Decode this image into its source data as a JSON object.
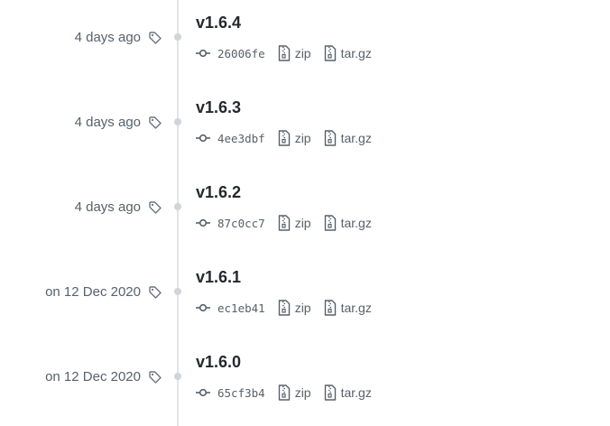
{
  "releases": [
    {
      "date": "4 days ago",
      "title": "v1.6.4",
      "commit": "26006fe",
      "assets": [
        "zip",
        "tar.gz"
      ]
    },
    {
      "date": "4 days ago",
      "title": "v1.6.3",
      "commit": "4ee3dbf",
      "assets": [
        "zip",
        "tar.gz"
      ]
    },
    {
      "date": "4 days ago",
      "title": "v1.6.2",
      "commit": "87c0cc7",
      "assets": [
        "zip",
        "tar.gz"
      ]
    },
    {
      "date": "on 12 Dec 2020",
      "title": "v1.6.1",
      "commit": "ec1eb41",
      "assets": [
        "zip",
        "tar.gz"
      ]
    },
    {
      "date": "on 12 Dec 2020",
      "title": "v1.6.0",
      "commit": "65cf3b4",
      "assets": [
        "zip",
        "tar.gz"
      ]
    }
  ],
  "icons": {
    "tag": "tag-icon",
    "commit": "git-commit-icon",
    "archive": "file-zip-icon"
  },
  "colors": {
    "muted_text": "#586069",
    "title_text": "#24292e",
    "timeline": "#e1e4e8",
    "dot": "#d1d5da"
  }
}
